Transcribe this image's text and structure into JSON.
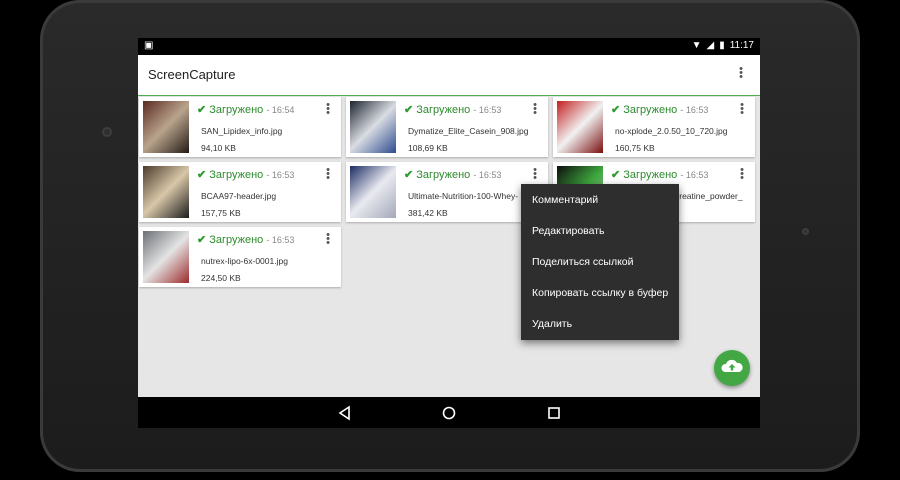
{
  "status_bar": {
    "time": "11:17"
  },
  "app_bar": {
    "title": "ScreenCapture"
  },
  "cards": [
    {
      "status": "Загружено",
      "time": "- 16:54",
      "filename": "SAN_Lipidex_info.jpg",
      "size": "94,10 KB",
      "thumb_colors": [
        "#5a2a22",
        "#b9a48c",
        "#231a15"
      ]
    },
    {
      "status": "Загружено",
      "time": "- 16:53",
      "filename": "Dymatize_Elite_Casein_908.jpg",
      "size": "108,69 KB",
      "thumb_colors": [
        "#1d2430",
        "#d9dce2",
        "#2d4b8f"
      ]
    },
    {
      "status": "Загружено",
      "time": "- 16:53",
      "filename": "no-xplode_2.0.50_10_720.jpg",
      "size": "160,75 KB",
      "thumb_colors": [
        "#c41e1e",
        "#f1f1f1",
        "#7a0e0e"
      ]
    },
    {
      "status": "Загружено",
      "time": "- 16:53",
      "filename": "BCAA97-header.jpg",
      "size": "157,75 KB",
      "thumb_colors": [
        "#4a3a2a",
        "#d8c7a8",
        "#1c1c1c"
      ]
    },
    {
      "status": "Загружено",
      "time": "- 16:53",
      "filename": "Ultimate-Nutrition-100-Whey-",
      "size": "381,42 KB",
      "thumb_colors": [
        "#1b2b64",
        "#e9eaf0",
        "#a3a8b9"
      ]
    },
    {
      "status": "Загружено",
      "time": "- 16:53",
      "filename": "creatine_powder_",
      "size": "",
      "thumb_colors": [
        "#0d0d0d",
        "#3ea83e",
        "#bfbfbf"
      ]
    },
    {
      "status": "Загружено",
      "time": "- 16:53",
      "filename": "nutrex-lipo-6x-0001.jpg",
      "size": "224,50 KB",
      "thumb_colors": [
        "#6b6f75",
        "#e4e4e4",
        "#9c2a2a"
      ]
    }
  ],
  "context_menu": {
    "items": [
      "Комментарий",
      "Редактировать",
      "Поделиться ссылкой",
      "Копировать ссылку в буфер",
      "Удалить"
    ]
  },
  "colors": {
    "accent": "#43a843",
    "menu_bg": "#2e2e2e"
  },
  "icons": {
    "fab": "cloud-upload-icon",
    "nav": [
      "back-icon",
      "home-icon",
      "recents-icon"
    ]
  }
}
